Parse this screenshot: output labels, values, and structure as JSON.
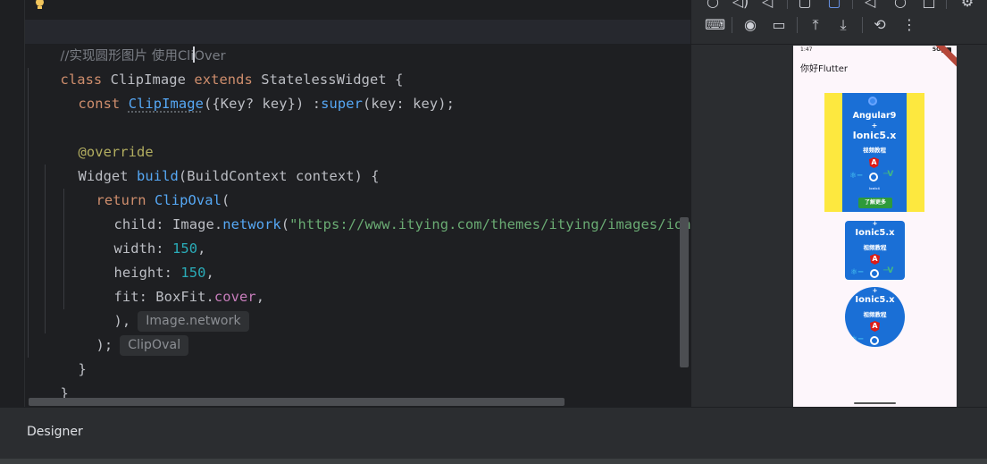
{
  "editor": {
    "comment": "//实现圆形图片 使用CliOver",
    "comment_before_caret": "//实现圆形图片 使用Cli",
    "comment_after_caret": "Over",
    "line_class_kw": "class",
    "line_class_name": " ClipImage ",
    "line_class_extends": "extends",
    "line_class_base": " StatelessWidget {",
    "line_ctor_kw": "const",
    "line_ctor_name": "ClipImage",
    "line_ctor_params": "({Key? key}) :",
    "line_ctor_super": "super",
    "line_ctor_rest": "(key: key);",
    "line_override": "@override",
    "line_build_type": "Widget",
    "line_build_fn": "build",
    "line_build_rest": "(BuildContext context) {",
    "line_return_kw": "return",
    "line_return_fn": "ClipOval",
    "line_return_rest": "(",
    "line_child_label": "child: Image.",
    "line_child_fn": "network",
    "line_child_paren": "(",
    "line_child_str": "\"https://www.itying.com/themes/itying/images/ion",
    "line_width_label": "width: ",
    "line_width_val": "150",
    "line_width_comma": ",",
    "line_height_label": "height: ",
    "line_height_val": "150",
    "line_height_comma": ",",
    "line_fit_label": "fit: BoxFit.",
    "line_fit_val": "cover",
    "line_fit_comma": ",",
    "line_close1": "),",
    "hint1": "Image.network",
    "line_close2": ");",
    "hint2": "ClipOval",
    "line_close3": "}",
    "line_close4": "}"
  },
  "toolbar": {
    "row1": [
      "○",
      "◁)",
      "◁",
      "▢",
      "◁",
      "○",
      "□",
      "⚙"
    ],
    "row2_keyboard": "⌨",
    "row2_camera": "◉",
    "row2_video": "▭",
    "row2_upload": "⤒",
    "row2_download": "⤓",
    "row2_rotate": "⟲",
    "row2_more": "⋮"
  },
  "phone": {
    "time": "1:47",
    "signal": "5G",
    "appbar_title": "你好Flutter",
    "img1_line1": "Angular9",
    "img1_plus": "+",
    "img1_line2": "Ionic5.x",
    "img1_line3": "视频教程",
    "img1_badge": "A",
    "img1_small": "ionic4",
    "img1_button": "了解更多",
    "img2_plus": "+",
    "img2_line1": "Ionic5.x",
    "img2_line2": "视频教程",
    "img2_badge": "A",
    "img3_plus": "+",
    "img3_line1": "Ionic5.x",
    "img3_line2": "视频教程",
    "img3_badge": "A"
  },
  "bottom": {
    "designer": "Designer"
  }
}
